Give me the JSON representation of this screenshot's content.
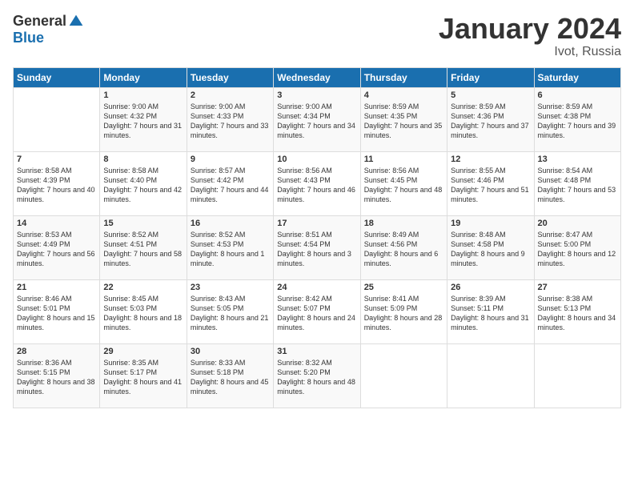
{
  "logo": {
    "general": "General",
    "blue": "Blue"
  },
  "title": "January 2024",
  "location": "Ivot, Russia",
  "days_header": [
    "Sunday",
    "Monday",
    "Tuesday",
    "Wednesday",
    "Thursday",
    "Friday",
    "Saturday"
  ],
  "weeks": [
    [
      {
        "day": "",
        "sunrise": "",
        "sunset": "",
        "daylight": ""
      },
      {
        "day": "1",
        "sunrise": "Sunrise: 9:00 AM",
        "sunset": "Sunset: 4:32 PM",
        "daylight": "Daylight: 7 hours and 31 minutes."
      },
      {
        "day": "2",
        "sunrise": "Sunrise: 9:00 AM",
        "sunset": "Sunset: 4:33 PM",
        "daylight": "Daylight: 7 hours and 33 minutes."
      },
      {
        "day": "3",
        "sunrise": "Sunrise: 9:00 AM",
        "sunset": "Sunset: 4:34 PM",
        "daylight": "Daylight: 7 hours and 34 minutes."
      },
      {
        "day": "4",
        "sunrise": "Sunrise: 8:59 AM",
        "sunset": "Sunset: 4:35 PM",
        "daylight": "Daylight: 7 hours and 35 minutes."
      },
      {
        "day": "5",
        "sunrise": "Sunrise: 8:59 AM",
        "sunset": "Sunset: 4:36 PM",
        "daylight": "Daylight: 7 hours and 37 minutes."
      },
      {
        "day": "6",
        "sunrise": "Sunrise: 8:59 AM",
        "sunset": "Sunset: 4:38 PM",
        "daylight": "Daylight: 7 hours and 39 minutes."
      }
    ],
    [
      {
        "day": "7",
        "sunrise": "Sunrise: 8:58 AM",
        "sunset": "Sunset: 4:39 PM",
        "daylight": "Daylight: 7 hours and 40 minutes."
      },
      {
        "day": "8",
        "sunrise": "Sunrise: 8:58 AM",
        "sunset": "Sunset: 4:40 PM",
        "daylight": "Daylight: 7 hours and 42 minutes."
      },
      {
        "day": "9",
        "sunrise": "Sunrise: 8:57 AM",
        "sunset": "Sunset: 4:42 PM",
        "daylight": "Daylight: 7 hours and 44 minutes."
      },
      {
        "day": "10",
        "sunrise": "Sunrise: 8:56 AM",
        "sunset": "Sunset: 4:43 PM",
        "daylight": "Daylight: 7 hours and 46 minutes."
      },
      {
        "day": "11",
        "sunrise": "Sunrise: 8:56 AM",
        "sunset": "Sunset: 4:45 PM",
        "daylight": "Daylight: 7 hours and 48 minutes."
      },
      {
        "day": "12",
        "sunrise": "Sunrise: 8:55 AM",
        "sunset": "Sunset: 4:46 PM",
        "daylight": "Daylight: 7 hours and 51 minutes."
      },
      {
        "day": "13",
        "sunrise": "Sunrise: 8:54 AM",
        "sunset": "Sunset: 4:48 PM",
        "daylight": "Daylight: 7 hours and 53 minutes."
      }
    ],
    [
      {
        "day": "14",
        "sunrise": "Sunrise: 8:53 AM",
        "sunset": "Sunset: 4:49 PM",
        "daylight": "Daylight: 7 hours and 56 minutes."
      },
      {
        "day": "15",
        "sunrise": "Sunrise: 8:52 AM",
        "sunset": "Sunset: 4:51 PM",
        "daylight": "Daylight: 7 hours and 58 minutes."
      },
      {
        "day": "16",
        "sunrise": "Sunrise: 8:52 AM",
        "sunset": "Sunset: 4:53 PM",
        "daylight": "Daylight: 8 hours and 1 minute."
      },
      {
        "day": "17",
        "sunrise": "Sunrise: 8:51 AM",
        "sunset": "Sunset: 4:54 PM",
        "daylight": "Daylight: 8 hours and 3 minutes."
      },
      {
        "day": "18",
        "sunrise": "Sunrise: 8:49 AM",
        "sunset": "Sunset: 4:56 PM",
        "daylight": "Daylight: 8 hours and 6 minutes."
      },
      {
        "day": "19",
        "sunrise": "Sunrise: 8:48 AM",
        "sunset": "Sunset: 4:58 PM",
        "daylight": "Daylight: 8 hours and 9 minutes."
      },
      {
        "day": "20",
        "sunrise": "Sunrise: 8:47 AM",
        "sunset": "Sunset: 5:00 PM",
        "daylight": "Daylight: 8 hours and 12 minutes."
      }
    ],
    [
      {
        "day": "21",
        "sunrise": "Sunrise: 8:46 AM",
        "sunset": "Sunset: 5:01 PM",
        "daylight": "Daylight: 8 hours and 15 minutes."
      },
      {
        "day": "22",
        "sunrise": "Sunrise: 8:45 AM",
        "sunset": "Sunset: 5:03 PM",
        "daylight": "Daylight: 8 hours and 18 minutes."
      },
      {
        "day": "23",
        "sunrise": "Sunrise: 8:43 AM",
        "sunset": "Sunset: 5:05 PM",
        "daylight": "Daylight: 8 hours and 21 minutes."
      },
      {
        "day": "24",
        "sunrise": "Sunrise: 8:42 AM",
        "sunset": "Sunset: 5:07 PM",
        "daylight": "Daylight: 8 hours and 24 minutes."
      },
      {
        "day": "25",
        "sunrise": "Sunrise: 8:41 AM",
        "sunset": "Sunset: 5:09 PM",
        "daylight": "Daylight: 8 hours and 28 minutes."
      },
      {
        "day": "26",
        "sunrise": "Sunrise: 8:39 AM",
        "sunset": "Sunset: 5:11 PM",
        "daylight": "Daylight: 8 hours and 31 minutes."
      },
      {
        "day": "27",
        "sunrise": "Sunrise: 8:38 AM",
        "sunset": "Sunset: 5:13 PM",
        "daylight": "Daylight: 8 hours and 34 minutes."
      }
    ],
    [
      {
        "day": "28",
        "sunrise": "Sunrise: 8:36 AM",
        "sunset": "Sunset: 5:15 PM",
        "daylight": "Daylight: 8 hours and 38 minutes."
      },
      {
        "day": "29",
        "sunrise": "Sunrise: 8:35 AM",
        "sunset": "Sunset: 5:17 PM",
        "daylight": "Daylight: 8 hours and 41 minutes."
      },
      {
        "day": "30",
        "sunrise": "Sunrise: 8:33 AM",
        "sunset": "Sunset: 5:18 PM",
        "daylight": "Daylight: 8 hours and 45 minutes."
      },
      {
        "day": "31",
        "sunrise": "Sunrise: 8:32 AM",
        "sunset": "Sunset: 5:20 PM",
        "daylight": "Daylight: 8 hours and 48 minutes."
      },
      {
        "day": "",
        "sunrise": "",
        "sunset": "",
        "daylight": ""
      },
      {
        "day": "",
        "sunrise": "",
        "sunset": "",
        "daylight": ""
      },
      {
        "day": "",
        "sunrise": "",
        "sunset": "",
        "daylight": ""
      }
    ]
  ]
}
